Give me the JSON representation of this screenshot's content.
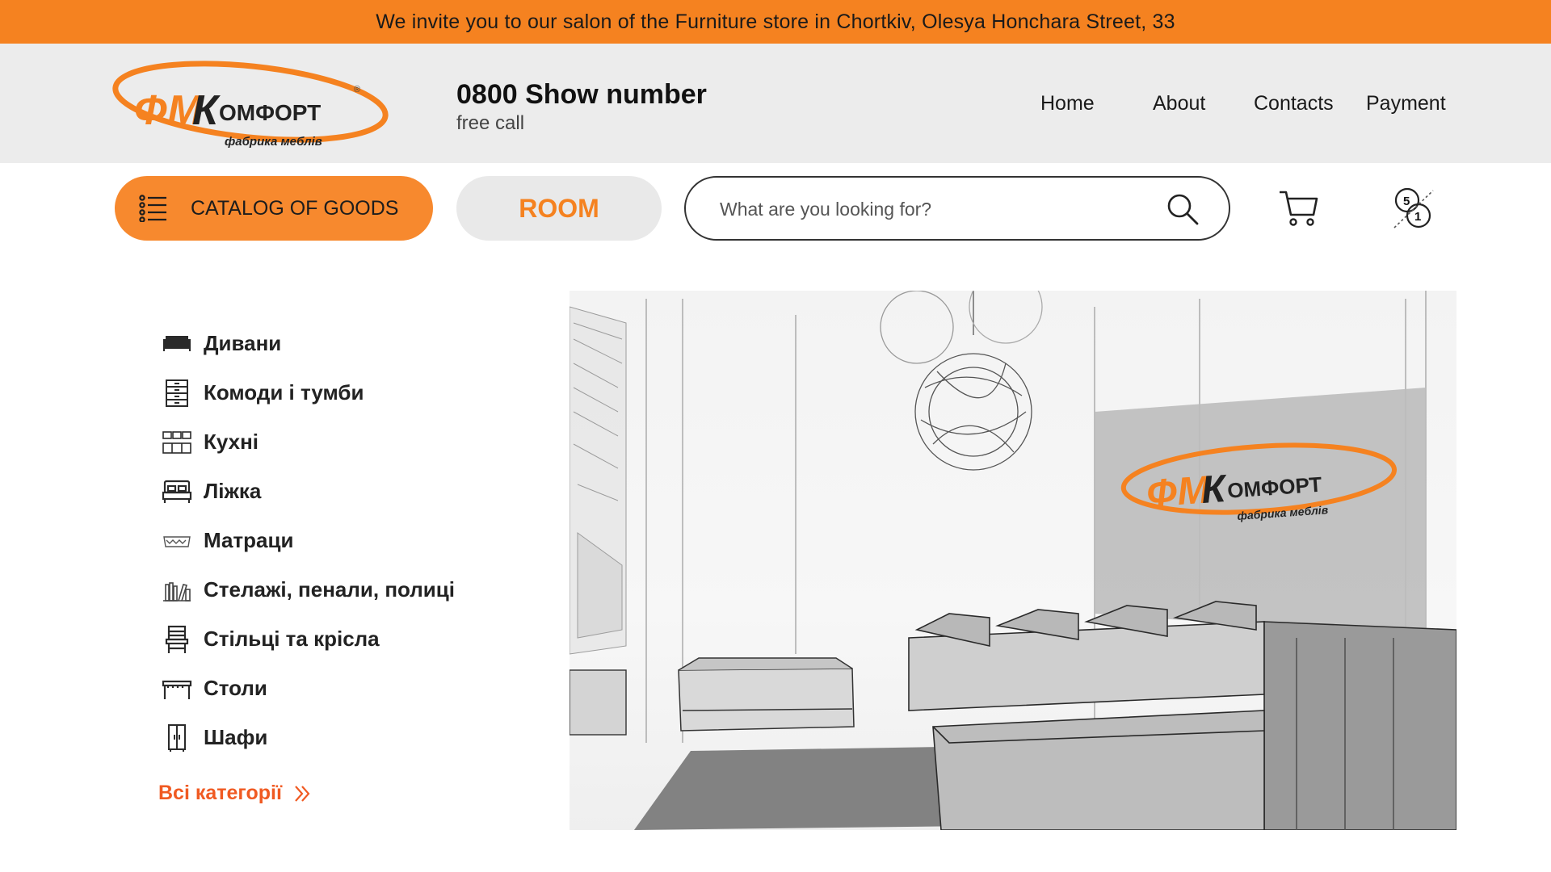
{
  "topbar": {
    "text": "We invite you to our salon of the Furniture store in Chortkiv, Olesya Honchara Street, 33"
  },
  "logo": {
    "text_main": "ФМКомфорт",
    "text_sub": "фабрика меблів",
    "registered": "®"
  },
  "phone": {
    "number": "0800 Show number",
    "note": "free call"
  },
  "nav": {
    "home": "Home",
    "about": "About",
    "contacts": "Contacts",
    "payment": "Payment"
  },
  "toolbar": {
    "catalog_label": "CATALOG OF GOODS",
    "room_label": "ROOM",
    "search_placeholder": "What are you looking for?",
    "compare_top": "5",
    "compare_bottom": "1"
  },
  "categories": [
    {
      "label": "Дивани",
      "icon": "sofa-icon"
    },
    {
      "label": "Комоди і тумби",
      "icon": "dresser-icon"
    },
    {
      "label": "Кухні",
      "icon": "kitchen-icon"
    },
    {
      "label": "Ліжка",
      "icon": "bed-icon"
    },
    {
      "label": "Матраци",
      "icon": "mattress-icon"
    },
    {
      "label": "Стелажі, пенали, полиці",
      "icon": "shelf-icon"
    },
    {
      "label": "Стільці та крісла",
      "icon": "chair-icon"
    },
    {
      "label": "Столи",
      "icon": "table-icon"
    },
    {
      "label": "Шафи",
      "icon": "wardrobe-icon"
    }
  ],
  "all_categories": "Всі категорії",
  "colors": {
    "accent": "#f58220",
    "header_bg": "#ececec",
    "link": "#f05a22"
  }
}
